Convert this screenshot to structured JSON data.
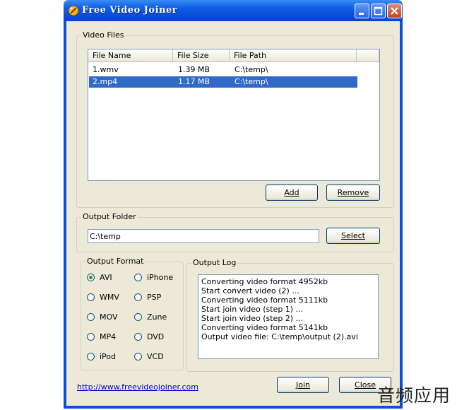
{
  "window": {
    "title": "Free Video Joiner"
  },
  "video_files": {
    "group_label": "Video Files",
    "columns": [
      "File Name",
      "File Size",
      "File Path"
    ],
    "rows": [
      [
        "1.wmv",
        "1.39 MB",
        "C:\\temp\\"
      ],
      [
        "2.mp4",
        "1.17 MB",
        "C:\\temp\\"
      ]
    ],
    "selected_row": 1,
    "add_label": "Add",
    "remove_label": "Remove"
  },
  "output_folder": {
    "group_label": "Output Folder",
    "value": "C:\\temp",
    "select_label": "Select"
  },
  "output_format": {
    "group_label": "Output Format",
    "selected": "AVI",
    "options": [
      "AVI",
      "iPhone",
      "WMV",
      "PSP",
      "MOV",
      "Zune",
      "MP4",
      "DVD",
      "iPod",
      "VCD"
    ]
  },
  "output_log": {
    "group_label": "Output Log",
    "lines": [
      "Converting video format 4952kb",
      "Start convert video (2) ...",
      "Converting video format 5111kb",
      "Start join video (step 1) ...",
      "Start join video (step 2) ...",
      "Converting video format 5141kb",
      "Output video file: C:\\temp\\output (2).avi"
    ]
  },
  "footer": {
    "website": "http://www.freevideojoiner.com",
    "join_label": "Join",
    "close_label": "Close"
  },
  "watermark": "音频应用"
}
